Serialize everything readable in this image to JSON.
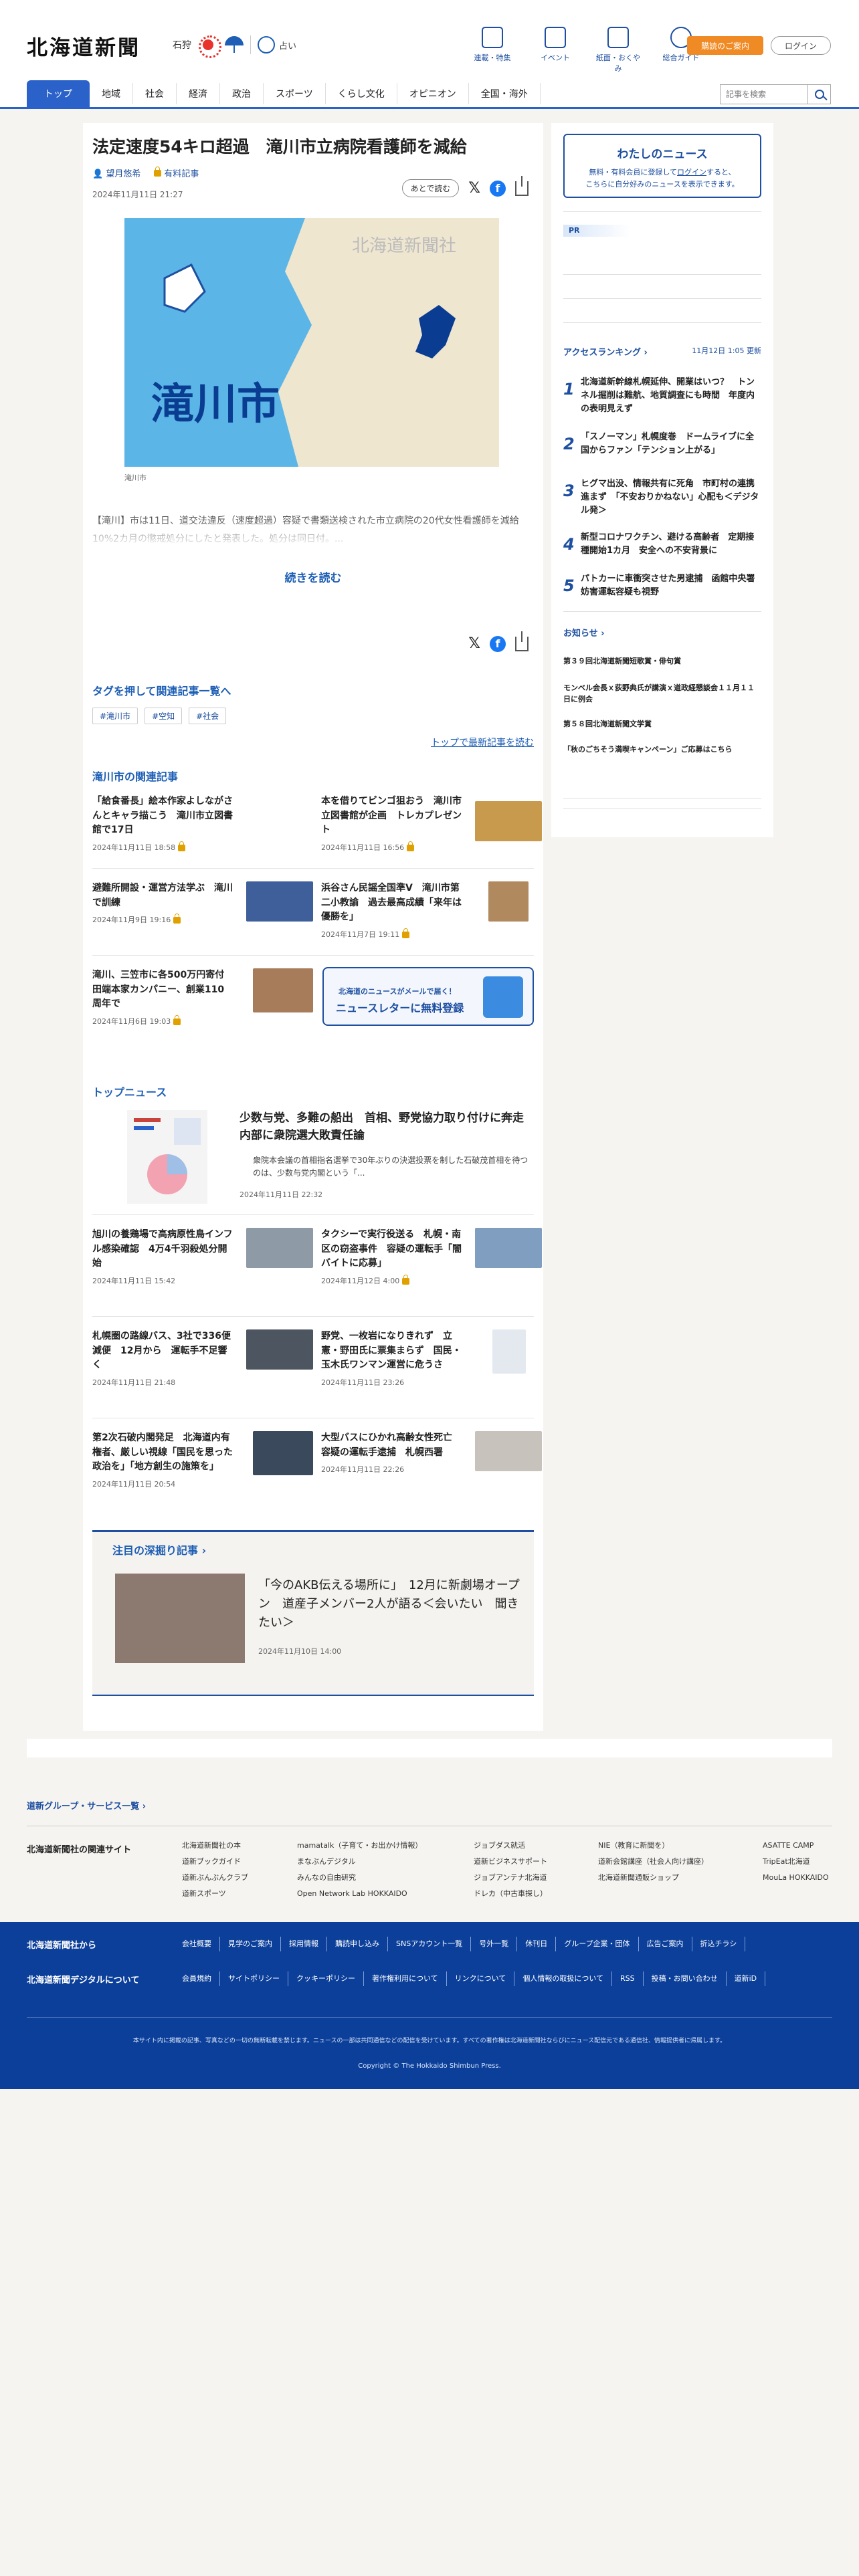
{
  "header": {
    "logo": "北海道新聞",
    "weather_city": "石狩",
    "fortune": "占い",
    "nav": [
      "連載・特集",
      "イベント",
      "紙面・おくやみ",
      "総合ガイド"
    ],
    "purchase_btn": "購読のご案内",
    "login_btn": "ログイン",
    "search_placeholder": "記事を検索",
    "tabs": [
      "トップ",
      "地域",
      "社会",
      "経済",
      "政治",
      "スポーツ",
      "くらし文化",
      "オピニオン",
      "全国・海外"
    ]
  },
  "article": {
    "title": "法定速度54キロ超過　滝川市立病院看護師を減給",
    "author": "望月悠希",
    "paid_label": "有料記事",
    "date": "2024年11月11日 21:27",
    "later_btn": "あとで読む",
    "image_city": "滝川市",
    "image_watermark": "北海道新聞社",
    "image_caption": "滝川市",
    "lead": "【滝川】市は11日、道交法違反（速度超過）容疑で書類送検された市立病院の20代女性看護師を減給10%2カ月の懲戒処分にしたと発表した。処分は同日付。...",
    "read_more": "続きを読む"
  },
  "tags": {
    "heading": "タグを押して関連記事一覧へ",
    "items": [
      "#滝川市",
      "#空知",
      "#社会"
    ],
    "top_link": "トップで最新記事を読む"
  },
  "related": {
    "heading": "滝川市の関連記事",
    "items": [
      {
        "title": "「給食番長」絵本作家よしながさんとキャラ描こう　滝川市立図書館で17日",
        "date": "2024年11月11日 18:58"
      },
      {
        "title": "本を借りてビンゴ狙おう　滝川市立図書館が企画　トレカプレゼント",
        "date": "2024年11月11日 16:56"
      },
      {
        "title": "避難所開設・運営方法学ぶ　滝川で訓練",
        "date": "2024年11月9日 19:16"
      },
      {
        "title": "浜谷さん民謡全国準V　滝川市第二小教諭　過去最高成績「来年は優勝を」",
        "date": "2024年11月7日 19:11"
      },
      {
        "title": "滝川、三笠市に各500万円寄付　田端本家カンパニー、創業110周年で",
        "date": "2024年11月6日 19:03"
      }
    ],
    "newsletter_l1": "北海道のニュースがメールで届く！",
    "newsletter_l2": "ニュースレターに無料登録"
  },
  "topnews": {
    "heading": "トップニュース",
    "hero": {
      "title": "少数与党、多難の船出　首相、野党協力取り付けに奔走　内部に衆院選大敗責任論",
      "summary": "衆院本会議の首相指名選挙で30年ぶりの決選投票を制した石破茂首相を待つのは、少数与党内閣という「...",
      "date": "2024年11月11日 22:32"
    },
    "items": [
      {
        "title": "旭川の養鶏場で高病原性鳥インフル感染確認　4万4千羽殺処分開始",
        "date": "2024年11月11日 15:42"
      },
      {
        "title": "タクシーで実行役送る　札幌・南区の窃盗事件　容疑の運転手「闇バイトに応募」",
        "date": "2024年11月12日 4:00"
      },
      {
        "title": "札幌圏の路線バス、3社で336便減便　12月から　運転手不足響く",
        "date": "2024年11月11日 21:48"
      },
      {
        "title": "野党、一枚岩になりきれず　立憲・野田氏に票集まらず　国民・玉木氏ワンマン運営に危うさ",
        "date": "2024年11月11日 23:26"
      },
      {
        "title": "第2次石破内閣発足　北海道内有権者、厳しい視線「国民を思った政治を」「地方創生の施策を」",
        "date": "2024年11月11日 20:54"
      },
      {
        "title": "大型バスにひかれ高齢女性死亡　容疑の運転手逮捕　札幌西署",
        "date": "2024年11月11日 22:26"
      }
    ]
  },
  "deep": {
    "heading": "注目の深掘り記事",
    "title": "「今のAKB伝える場所に」　12月に新劇場オープン　道産子メンバー2人が語る＜会いたい　聞きたい＞",
    "date": "2024年11月10日 14:00"
  },
  "sidebar": {
    "mynews_title": "わたしのニュース",
    "mynews_text_1": "無料・有料会員に登録して",
    "mynews_login": "ログイン",
    "mynews_text_2": "すると、",
    "mynews_text_3": "こちらに自分好みのニュースを表示できます。",
    "pr": "PR",
    "ranking_heading": "アクセスランキング",
    "ranking_updated": "11月12日 1:05 更新",
    "ranking": [
      "北海道新幹線札幌延伸、開業はいつ？　トンネル掘削は難航、地質調査にも時間　年度内の表明見えず",
      "「スノーマン」札幌度巻　ドームライブに全国からファン「テンション上がる」",
      "ヒグマ出没、情報共有に死角　市町村の連携進まず　「不安おりかねない」心配も＜デジタル発＞",
      "新型コロナワクチン、避ける高齢者　定期接種開始1カ月　安全への不安背景に",
      "パトカーに車衝突させた男逮捕　函館中央署　妨害運転容疑も視野"
    ],
    "notice_heading": "お知らせ",
    "notices": [
      "第３９回北海道新聞短歌賞・俳句賞",
      "モンベル会長ｘ荻野典氏が講演ｘ道政経懇談会１１月１１日に例会",
      "第５８回北海道新聞文学賞",
      "「秋のごちそう満喫キャンペーン」ご応募はこちら"
    ]
  },
  "footer": {
    "group_link": "道新グループ・サービス一覧",
    "related_heading": "北海道新聞社の関連サイト",
    "related_cols": [
      [
        "北海道新聞社の本",
        "道新ブックガイド",
        "道新ぶんぶんクラブ",
        "道新スポーツ"
      ],
      [
        "mamatalk（子育て・お出かけ情報）",
        "まなぶんデジタル",
        "みんなの自由研究",
        "Open Network Lab HOKKAIDO"
      ],
      [
        "ジョブダス就活",
        "道新ビジネスサポート",
        "ジョブアンテナ北海道",
        "ドレカ（中古車探し）"
      ],
      [
        "NIE（教育に新聞を）",
        "道新会館講座（社会人向け講座）",
        "北海道新聞通販ショップ"
      ],
      [
        "ASATTE CAMP",
        "TripEat北海道",
        "MouLa HOKKAIDO"
      ]
    ],
    "label_company": "北海道新聞社から",
    "label_digital": "北海道新聞デジタルについて",
    "links_company": [
      "会社概要",
      "見学のご案内",
      "採用情報",
      "購読申し込み",
      "SNSアカウント一覧",
      "号外一覧",
      "休刊日",
      "グループ企業・団体",
      "広告ご案内",
      "折込チラシ"
    ],
    "links_digital": [
      "会員規約",
      "サイトポリシー",
      "クッキーポリシー",
      "著作権利用について",
      "リンクについて",
      "個人情報の取扱について",
      "RSS",
      "投稿・お問い合わせ",
      "道新iD"
    ],
    "note": "本サイト内に掲載の記事、写真などの一切の無断転載を禁じます。ニュースの一部は共同通信などの配信を受けています。すべての著作権は北海道新聞社ならびにニュース配信元である通信社、情報提供者に帰属します。",
    "copyright": "Copyright © The Hokkaido Shimbun Press."
  }
}
